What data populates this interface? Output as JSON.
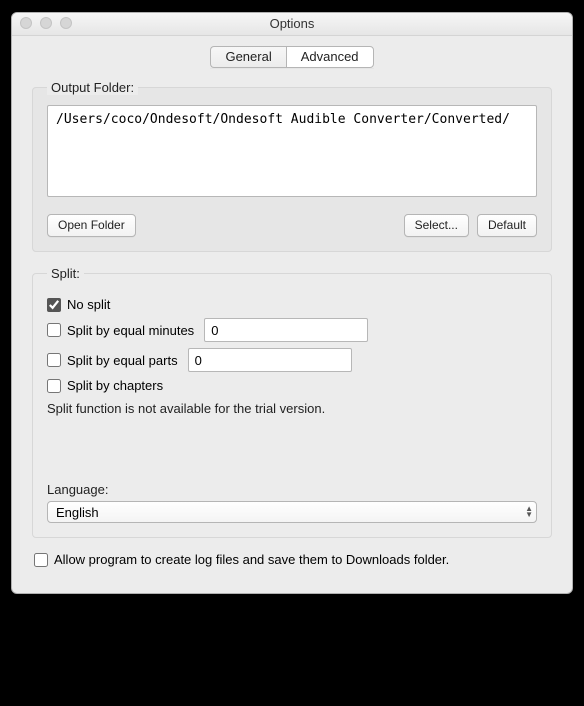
{
  "window": {
    "title": "Options"
  },
  "tabs": {
    "general": "General",
    "advanced": "Advanced",
    "active": "advanced"
  },
  "output": {
    "legend": "Output Folder:",
    "path": "/Users/coco/Ondesoft/Ondesoft Audible Converter/Converted/",
    "open_label": "Open Folder",
    "select_label": "Select...",
    "default_label": "Default"
  },
  "split": {
    "legend": "Split:",
    "no_split_label": "No split",
    "no_split_checked": true,
    "by_minutes_label": "Split by equal minutes",
    "by_minutes_checked": false,
    "by_minutes_value": "0",
    "by_parts_label": "Split by equal parts",
    "by_parts_checked": false,
    "by_parts_value": "0",
    "by_chapters_label": "Split by chapters",
    "by_chapters_checked": false,
    "note": "Split function is not available for the trial version."
  },
  "language": {
    "label": "Language:",
    "value": "English"
  },
  "log": {
    "label": "Allow program to create log files and save them to Downloads folder.",
    "checked": false
  }
}
